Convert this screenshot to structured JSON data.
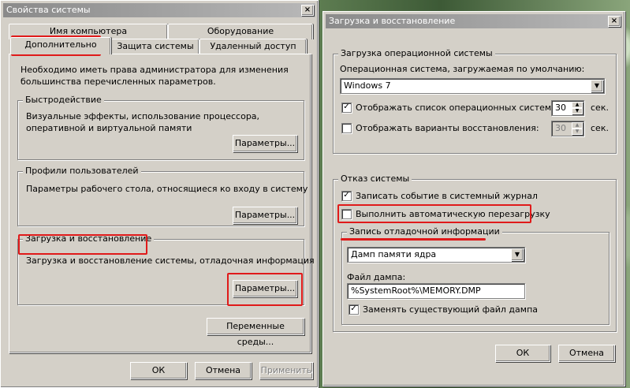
{
  "left": {
    "title": "Свойства системы",
    "close": "×",
    "tabs_top": [
      "Имя компьютера",
      "Оборудование"
    ],
    "tabs_bottom": [
      "Дополнительно",
      "Защита системы",
      "Удаленный доступ"
    ],
    "admin_note": "Необходимо иметь права администратора для изменения большинства перечисленных параметров.",
    "perf": {
      "title": "Быстродействие",
      "desc": "Визуальные эффекты, использование процессора, оперативной и виртуальной памяти",
      "button": "Параметры..."
    },
    "profiles": {
      "title": "Профили пользователей",
      "desc": "Параметры рабочего стола, относящиеся ко входу в систему",
      "button": "Параметры..."
    },
    "startup": {
      "title": "Загрузка и восстановление",
      "desc": "Загрузка и восстановление системы, отладочная информация",
      "button": "Параметры..."
    },
    "env_button": "Переменные среды...",
    "ok": "ОК",
    "cancel": "Отмена",
    "apply": "Применить"
  },
  "right": {
    "title": "Загрузка и восстановление",
    "close": "×",
    "os_group": {
      "title": "Загрузка операционной системы",
      "default_label": "Операционная система, загружаемая по умолчанию:",
      "default_value": "Windows 7",
      "show_list_label": "Отображать список операционных систем:",
      "show_list_checked": true,
      "show_list_value": "30",
      "recovery_label": "Отображать варианты восстановления:",
      "recovery_checked": false,
      "recovery_value": "30",
      "unit": "сек."
    },
    "failure_group": {
      "title": "Отказ системы",
      "write_event_label": "Записать событие в системный журнал",
      "write_event_checked": true,
      "auto_restart_label": "Выполнить автоматическую перезагрузку",
      "auto_restart_checked": false,
      "debug_group": {
        "title": "Запись отладочной информации",
        "type_value": "Дамп памяти ядра",
        "dump_file_label": "Файл дампа:",
        "dump_file_value": "%SystemRoot%\\MEMORY.DMP",
        "overwrite_label": "Заменять существующий файл дампа",
        "overwrite_checked": true
      }
    },
    "ok": "ОК",
    "cancel": "Отмена"
  },
  "colors": {
    "highlight": "#e01a1a",
    "dialog": "#d4d0c8",
    "titlebar": "#a0a0a0"
  }
}
